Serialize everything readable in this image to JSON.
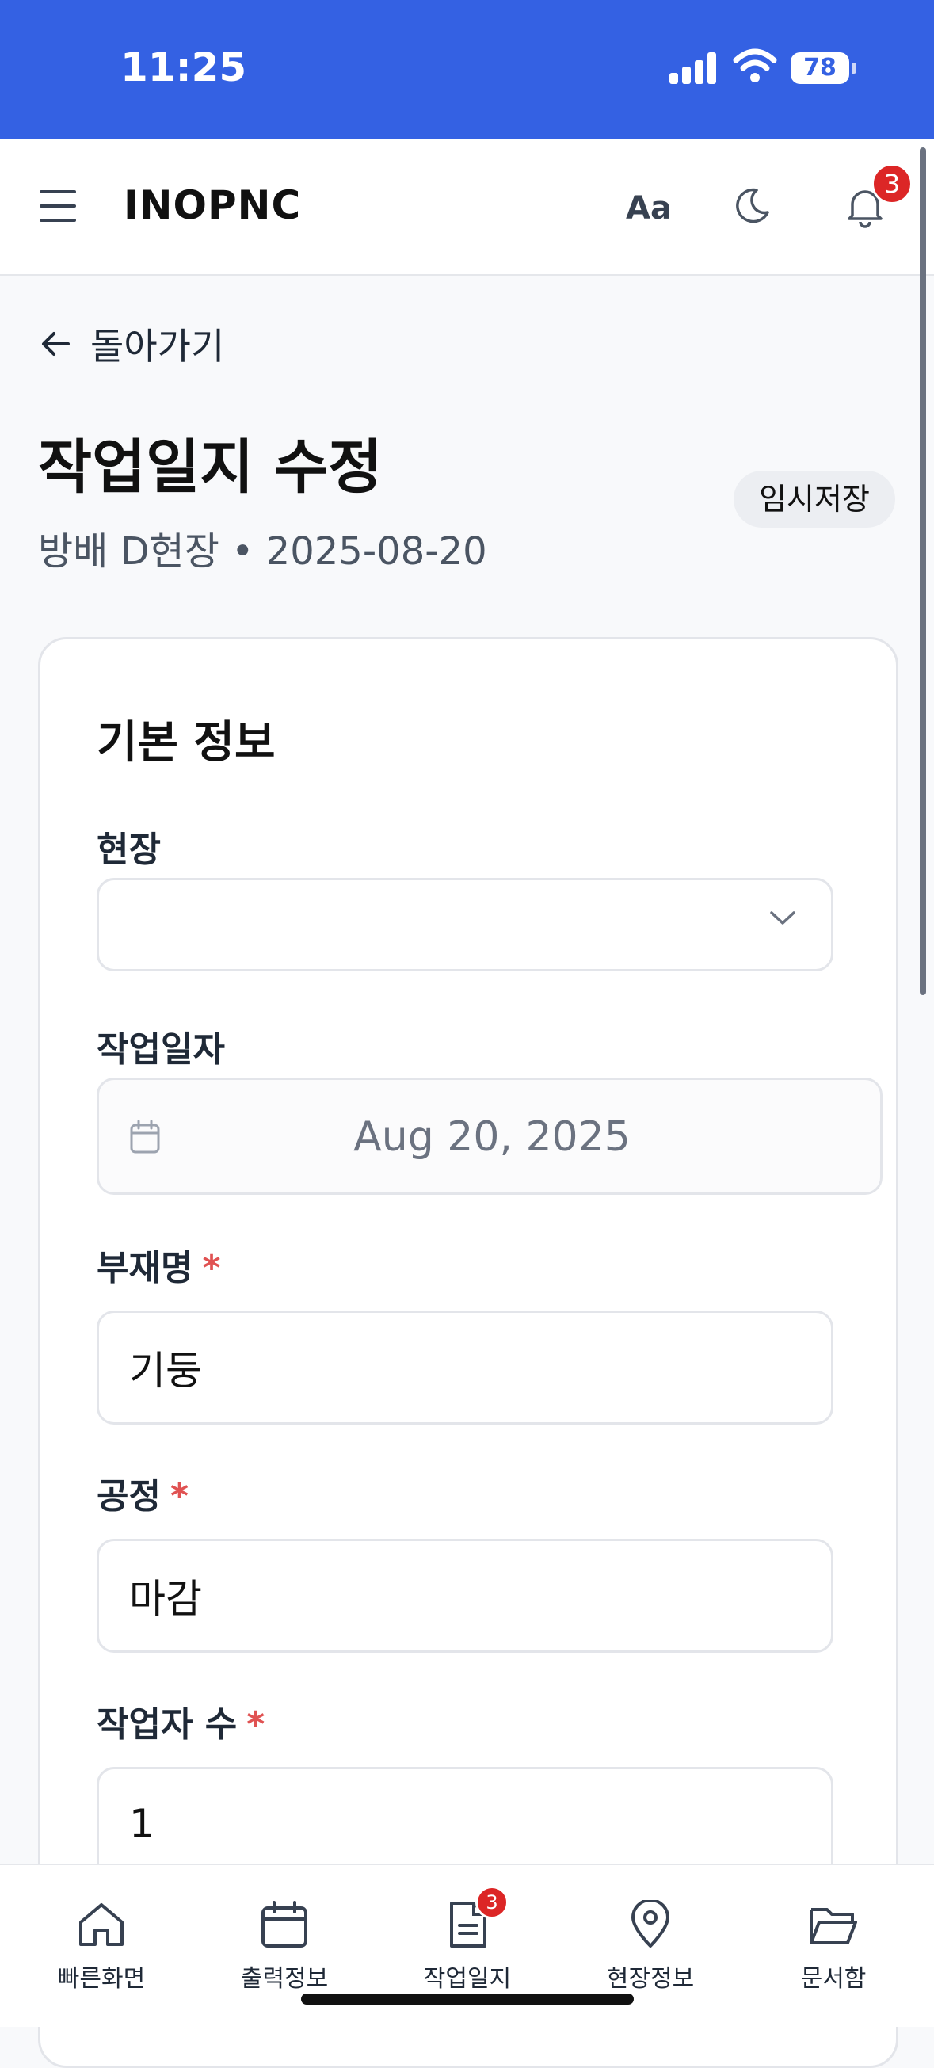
{
  "status_bar": {
    "time": "11:25",
    "battery": "78"
  },
  "header": {
    "brand": "INOPNC",
    "font_size_label": "Aa",
    "notification_count": "3"
  },
  "page": {
    "back_label": "돌아가기",
    "title": "작업일지 수정",
    "subtitle": "방배 D현장 • 2025-08-20",
    "draft_badge": "임시저장"
  },
  "form": {
    "section_title": "기본 정보",
    "site_label": "현장",
    "site_value": "",
    "date_label": "작업일자",
    "date_value": "Aug 20, 2025",
    "member_label": "부재명",
    "member_value": "기둥",
    "process_label": "공정",
    "process_value": "마감",
    "workers_label": "작업자 수",
    "workers_value": "1",
    "required_mark": "*"
  },
  "bottom_nav": {
    "items": [
      {
        "label": "빠른화면",
        "icon": "home-icon"
      },
      {
        "label": "출력정보",
        "icon": "calendar-icon"
      },
      {
        "label": "작업일지",
        "icon": "document-icon",
        "badge": "3"
      },
      {
        "label": "현장정보",
        "icon": "map-pin-icon"
      },
      {
        "label": "문서함",
        "icon": "folder-icon"
      }
    ]
  },
  "colors": {
    "status_bar": "#3461e3",
    "badge": "#dc2626",
    "required": "#e05252"
  }
}
